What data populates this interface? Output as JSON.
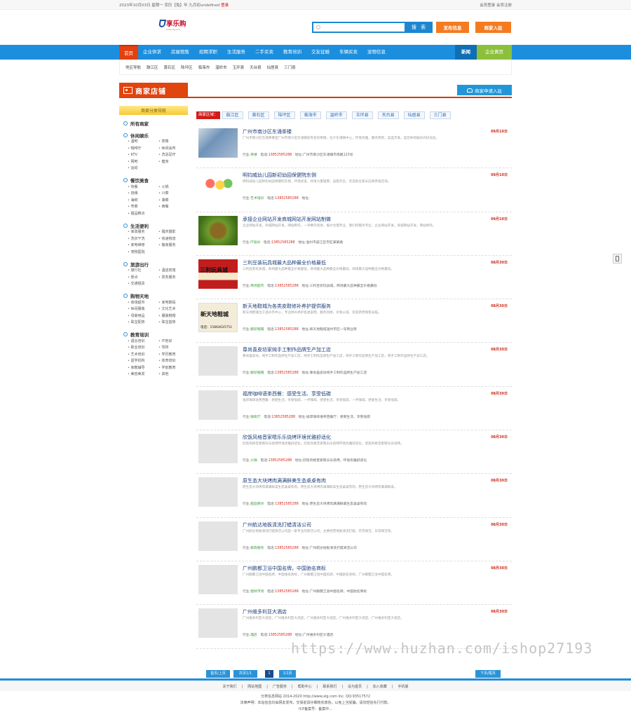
{
  "topbar": {
    "date": "2023年10月03日 星期一",
    "weather_prefix": "",
    "weather": "农历【兔】年 九月初undefined",
    "weather_tag": "登录",
    "login": "会员登录",
    "reg": "会员注册"
  },
  "logo": {
    "text": "享乐购",
    "sub": "www.xlg.com"
  },
  "search": {
    "placeholder": "",
    "button": "搜 索"
  },
  "actions": {
    "post": "发布信息",
    "merchant": "商家入驻"
  },
  "nav": {
    "items": [
      "首页",
      "企业供求",
      "房屋租售",
      "招聘求职",
      "生活服务",
      "二手买卖",
      "教育培训",
      "交友征婚",
      "车辆买卖",
      "宠物信息"
    ],
    "xinwen": "新闻",
    "qiye": "企业黄页"
  },
  "subnav": [
    "地区导航",
    "鼓江区",
    "黄石区",
    "陆坪区",
    "临海市",
    "温岭市",
    "玉环县",
    "天台县",
    "仙居县",
    "三门县"
  ],
  "shop": {
    "title": "商家店铺",
    "apply": "商家申请入驻",
    "side_nav": "商家分类导航"
  },
  "categories": [
    {
      "title": "所有商家",
      "items": []
    },
    {
      "title": "休闲娱乐",
      "items": [
        "酒吧",
        "茶楼",
        "咖啡厅",
        "休闲会所",
        "KTV",
        "洗浴足疗",
        "网吧",
        "健身",
        "运动"
      ]
    },
    {
      "title": "餐饮美食",
      "items": [
        "快餐",
        "火锅",
        "烧烤",
        "川菜",
        "海鲜",
        "湘菜",
        "粤菜",
        "西餐",
        "甜品糕点"
      ]
    },
    {
      "title": "生活便利",
      "items": [
        "家政服务",
        "婚庆摄影",
        "洗衣干洗",
        "快递物流",
        "家电维修",
        "搬家服务",
        "宠物医院"
      ]
    },
    {
      "title": "旅游出行",
      "items": [
        "旅行社",
        "酒店宾馆",
        "景点",
        "票务服务",
        "交通租赁"
      ]
    },
    {
      "title": "购物天地",
      "items": [
        "商场超市",
        "家电数码",
        "休闲服装",
        "文化艺术",
        "母婴用品",
        "服装鞋帽",
        "珠宝配饰",
        "珠宝首饰"
      ]
    },
    {
      "title": "教育培训",
      "items": [
        "语言培训",
        "IT培训",
        "职业培训",
        "驾校",
        "艺术培训",
        "学历教育",
        "留学机构",
        "体育培训",
        "家教辅导",
        "学前教育",
        "美容美发",
        "其他"
      ]
    }
  ],
  "region": {
    "label": "商家区域：",
    "items": [
      "鼓江区",
      "黄石区",
      "陆坪区",
      "临海市",
      "温岭市",
      "玉环县",
      "天台县",
      "仙居县",
      "三门县"
    ]
  },
  "meta_labels": {
    "industry": "行业:",
    "phone": "电话:",
    "addr": "地址:"
  },
  "listings": [
    {
      "title": "广州市南沙区东涌茶楼",
      "date": "09月10日",
      "desc": "广州市南沙区东涌茶楼是广州市南沙区东涌镇较有名的茶楼，位于东涌镇中心，环境优雅，服务周到，菜品丰富，是您休闲娱乐的好去处。",
      "industry": "茶楼",
      "phone": "13852585288",
      "addr": "广州市南沙区东涌镇市南路123号"
    },
    {
      "title": "明钧威幼儿园新初幼园保健院东侧",
      "date": "09月10日",
      "desc": "明钧威幼儿园新初幼园保健院东侧，环境优美，师资力量雄厚，设施齐全，欢迎各位家长前来参观咨询。",
      "industry": "艺术培训",
      "phone": "13852585288",
      "addr": "",
      "img_label": ""
    },
    {
      "title": "承接企业网站开发商城网站开发网站制做",
      "date": "09月10日",
      "desc": "企业网站开发，商城网站开发，网站制作，一手精华资源，报价合理专业，我们的服务专业，企业网站开发，商城网站开发，网站制作。",
      "industry": "IT培训",
      "phone": "13852585288",
      "addr": "温州市鼓江区市区某某路"
    },
    {
      "title": "三利豆装玩具城最大品种最全价格最低",
      "date": "08月30日",
      "desc": "三利豆装玩具城，商场最大品种最全价格最低，商场最大品种最全价格最低，商场最大品种最全价格最低。",
      "industry": "商场超市",
      "phone": "13852585288",
      "addr": "三利豆装玩具城，商场最大品种最全价格最低",
      "img_label": "三利玩具城"
    },
    {
      "title": "新天地鞋城为各类皮鞋修补养护提供服务",
      "date": "08月30日",
      "desc": "新天地鞋城位于温州市中心，专业修补养护各类皮鞋，服务热情，价格公道，欢迎新老顾客光临。",
      "industry": "服装鞋帽",
      "phone": "13852585288",
      "addr": "新天地鞋城温州市区一号商业街",
      "img_label": "新天地鞋城",
      "img_sub": "电话：15864635751"
    },
    {
      "title": "尊尚喜皮坊家纯手工制作品牌生产加工店",
      "date": "08月30日",
      "desc": "尊尚喜皮坊，纯手工制作品牌生产加工店，纯手工制作品牌生产加工店，纯手工制作品牌生产加工店，纯手工制作品牌生产加工店。",
      "industry": "服装鞋帽",
      "phone": "13852585288",
      "addr": "尊尚喜皮坊纯手工制作品牌生产加工店"
    },
    {
      "title": "福岸咖啡语茶西餐：感受生活、享受低碳",
      "date": "08月30日",
      "desc": "福岸咖啡语茶西餐：感受生活，享受低碳，一手咖啡，感受生活，享受低碳，一手咖啡，感受生活，享受低碳。",
      "industry": "咖啡厅",
      "phone": "13852585288",
      "addr": "福岸咖啡语茶西餐厅：感受生活，享受低碳"
    },
    {
      "title": "欣饭风格音家嗯乐乐烧烤环境优雅舒适化",
      "date": "08月30日",
      "desc": "欣饭风格音家嗯乐乐烧烤环境优雅舒适化，欣饭风格音家嗯乐乐烧烤环境优雅舒适化，欣饭风格音家嗯乐乐烧烤。",
      "industry": "火锅",
      "phone": "13852585288",
      "addr": "欣饭风格音家嗯乐乐烧烤，环境优雅舒适化"
    },
    {
      "title": "原生态大块烤肉满满鲜美生态桌桌有肉",
      "date": "08月30日",
      "desc": "原生态大块烤肉满满鲜美生态桌桌有肉，原生态大块烤肉满满鲜美生态桌桌有肉，原生态大块烤肉满满鲜美。",
      "industry": "甜品糕点",
      "phone": "13852585288",
      "addr": "原生态大块烤肉满满鲜美生态桌桌有肉"
    },
    {
      "title": "广州航达地板清洗打蜡清洁公司",
      "date": "08月30日",
      "desc": "广州航达地板清洗打蜡清洁公司是一家专业的保洁公司，主要经营地板清洗打蜡，开荒保洁，日常保洁等。",
      "industry": "家政服务",
      "phone": "13852585288",
      "addr": "广州航达地板清洗打蜡清洁公司"
    },
    {
      "title": "广州鹏都卫浴中国名牌，中国驰名商标",
      "date": "08月30日",
      "desc": "广州鹏都卫浴中国名牌，中国驰名商标，广州鹏都卫浴中国名牌，中国驰名商标，广州鹏都卫浴中国名牌。",
      "industry": "建材市场",
      "phone": "13852585288",
      "addr": "广州鹏都卫浴中国名牌，中国驰名商标"
    },
    {
      "title": "广州维多利亚大酒店",
      "date": "08月30日",
      "desc": "广州维多利亚大酒店，广州维多利亚大酒店，广州维多利亚大酒店，广州维多利亚大酒店，广州维多利亚大酒店。",
      "industry": "酒店",
      "phone": "13852585288",
      "addr": "广州维多利亚大酒店"
    }
  ],
  "pager": {
    "first": "首页/上页",
    "info": "共页1/1",
    "cur": "1",
    "total": "1/1页",
    "last": "下页/尾页"
  },
  "footer": {
    "links": [
      "关于我们",
      "网站地图",
      "广告服务",
      "帮助中心",
      "联系我们",
      "设为首页",
      "加入收藏",
      "手机版"
    ],
    "copyright": "分类信息网站 2014-2020 http://www.xlg.com Inc. QQ:93517572",
    "notice": "法律声明：本站信息均由网友发布，交易前请仔细核实真伪，以免上当受骗，请勿轻信先行付款。",
    "icp": "ICP备案号：备案中..."
  },
  "watermark": "https://www.huzhan.com/ishop27193"
}
